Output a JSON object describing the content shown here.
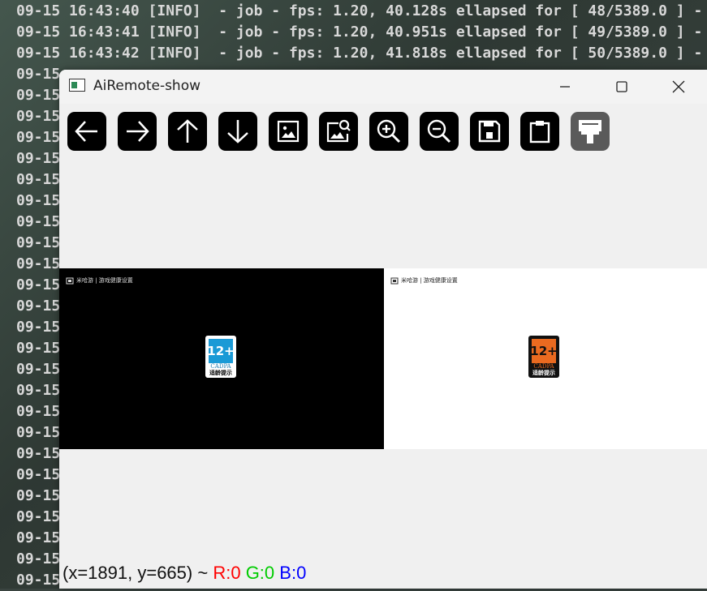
{
  "terminal": {
    "lines": [
      "09-15 16:43:40 [INFO]  - job - fps: 1.20, 40.128s ellapsed for [ 48/5389.0 ] -",
      "09-15 16:43:41 [INFO]  - job - fps: 1.20, 40.951s ellapsed for [ 49/5389.0 ] -",
      "09-15 16:43:42 [INFO]  - job - fps: 1.20, 41.818s ellapsed for [ 50/5389.0 ] -",
      "09-15",
      "09-15",
      "09-15",
      "09-15",
      "09-15",
      "09-15",
      "09-15",
      "09-15",
      "09-15",
      "09-15",
      "09-15",
      "09-15",
      "09-15",
      "09-15",
      "09-15",
      "09-15",
      "09-15",
      "09-15",
      "09-15",
      "09-15",
      "09-15",
      "09-15",
      "09-15",
      "09-15",
      "09-15"
    ]
  },
  "window": {
    "title": "AiRemote-show",
    "controls": [
      "minimize",
      "maximize",
      "close"
    ]
  },
  "toolbar": {
    "buttons": [
      {
        "icon": "arrow-left-icon",
        "enabled": true
      },
      {
        "icon": "arrow-right-icon",
        "enabled": true
      },
      {
        "icon": "arrow-up-icon",
        "enabled": true
      },
      {
        "icon": "arrow-down-icon",
        "enabled": true
      },
      {
        "icon": "image-icon",
        "enabled": true
      },
      {
        "icon": "image-search-icon",
        "enabled": true
      },
      {
        "icon": "zoom-in-icon",
        "enabled": true
      },
      {
        "icon": "zoom-out-icon",
        "enabled": true
      },
      {
        "icon": "save-icon",
        "enabled": true
      },
      {
        "icon": "clipboard-icon",
        "enabled": true
      },
      {
        "icon": "paint-brush-icon",
        "enabled": false
      }
    ]
  },
  "images": {
    "left": {
      "background": "#000000",
      "header_text": "米哈游 | 游戏健康设置",
      "badge": {
        "age": "12+",
        "org": "CADPA",
        "caption": "适龄提示",
        "color": "#1a9ad6"
      }
    },
    "right": {
      "background": "#ffffff",
      "header_text": "米哈游 | 游戏健康设置",
      "badge": {
        "age": "12+",
        "org": "CADPA",
        "caption": "适龄提示",
        "color": "#ea6a20"
      }
    }
  },
  "status": {
    "coords": "(x=1891, y=665) ~",
    "r": "R:0",
    "g": "G:0",
    "b": "B:0"
  }
}
